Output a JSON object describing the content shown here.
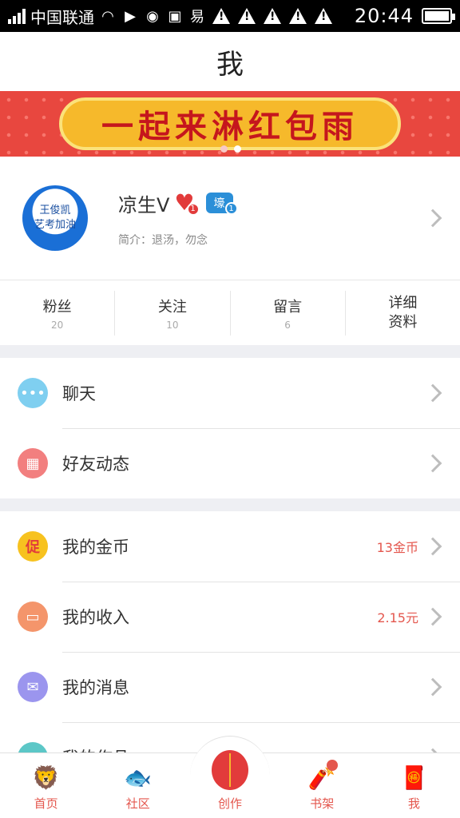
{
  "status_bar": {
    "carrier": "中国联通",
    "time": "20:44"
  },
  "title": "我",
  "banner": {
    "text": "一起来淋红包雨"
  },
  "profile": {
    "avatar_text_line1": "王俊凯",
    "avatar_text_line2": "艺考加油",
    "username": "凉生V",
    "heart_badge_count": "1",
    "level_badge_text": "壕",
    "level_badge_count": "1",
    "bio": "简介：退汤，勿念"
  },
  "stats": [
    {
      "label": "粉丝",
      "value": "20"
    },
    {
      "label": "关注",
      "value": "10"
    },
    {
      "label": "留言",
      "value": "6"
    },
    {
      "label_line1": "详细",
      "label_line2": "资料"
    }
  ],
  "list_group1": [
    {
      "label": "聊天",
      "icon": "chat-icon",
      "color": "#7fcff0"
    },
    {
      "label": "好友动态",
      "icon": "grid-icon",
      "color": "#f27f7f"
    }
  ],
  "list_group2": [
    {
      "label": "我的金币",
      "icon": "promo-icon",
      "color": "#f7c21f",
      "icon_text": "促",
      "value": "13金币"
    },
    {
      "label": "我的收入",
      "icon": "wallet-icon",
      "color": "#f4956b",
      "value": "2.15元"
    },
    {
      "label": "我的消息",
      "icon": "mail-icon",
      "color": "#9b95ee"
    },
    {
      "label": "我的作品",
      "icon": "doc-icon",
      "color": "#5cc7c7"
    }
  ],
  "bottom_nav": [
    {
      "label": "首页",
      "icon": "lion-dance-icon"
    },
    {
      "label": "社区",
      "icon": "koi-icon"
    },
    {
      "label": "创作",
      "icon": "lantern-icon"
    },
    {
      "label": "书架",
      "icon": "firecracker-icon"
    },
    {
      "label": "我",
      "icon": "fortune-god-icon"
    }
  ],
  "colors": {
    "accent": "#e4574e",
    "banner_bg": "#e8473f",
    "section_gap": "#eeeff3"
  }
}
